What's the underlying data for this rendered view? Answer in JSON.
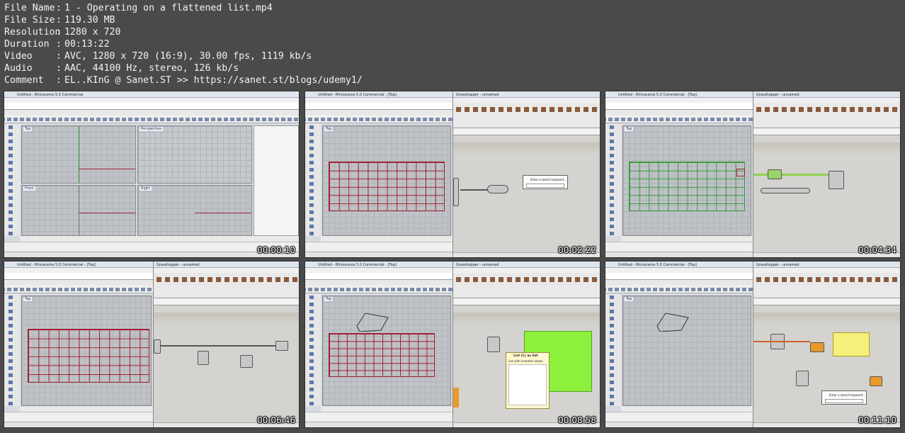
{
  "file_info": {
    "rows": [
      {
        "key": "File Name",
        "value": "1 - Operating on a flattened list.mp4"
      },
      {
        "key": "File Size",
        "value": "119.30 MB"
      },
      {
        "key": "Resolution",
        "value": "1280 x 720"
      },
      {
        "key": "Duration",
        "value": "00:13:22"
      },
      {
        "key": "Video",
        "value": "AVC, 1280 x 720 (16:9), 30.00 fps, 1119 kb/s"
      },
      {
        "key": "Audio",
        "value": "AAC, 44100 Hz, stereo, 126 kb/s"
      },
      {
        "key": "Comment",
        "value": "EL..KInG @ Sanet.ST >> https://sanet.st/blogs/udemy1/"
      }
    ],
    "separator": ":"
  },
  "thumbnails": [
    {
      "timestamp": "00:00:10",
      "rhino_title": "Untitled - Rhinoceros 5.0 Commercial"
    },
    {
      "timestamp": "00:02:22",
      "rhino_title": "Untitled - Rhinoceros 5.0 Commercial - [Top]",
      "gh_title": "Grasshopper - unnamed",
      "search_text": "Enter a search keyword..."
    },
    {
      "timestamp": "00:04:34",
      "rhino_title": "Untitled - Rhinoceros 5.0 Commercial - [Top]",
      "gh_title": "Grasshopper - unnamed"
    },
    {
      "timestamp": "00:06:46",
      "rhino_title": "Untitled - Rhinoceros 5.0 Commercial - [Top]",
      "gh_title": "Grasshopper - unnamed"
    },
    {
      "timestamp": "00:08:58",
      "rhino_title": "Untitled - Rhinoceros 5.0 Commercial - [Top]",
      "gh_title": "Grasshopper - unnamed",
      "tooltip_title": "List (L) as list",
      "tooltip_sub": "List with inserted values"
    },
    {
      "timestamp": "00:11:10",
      "rhino_title": "Untitled - Rhinoceros 5.0 Commercial - [Top]",
      "gh_title": "Grasshopper - unnamed",
      "search_text": "Enter a search keyword..."
    }
  ],
  "colors": {
    "background": "#4a4a4a",
    "text": "#f2f2f2",
    "red_grid": "#a02030",
    "green_grid": "#3a9a3a"
  }
}
